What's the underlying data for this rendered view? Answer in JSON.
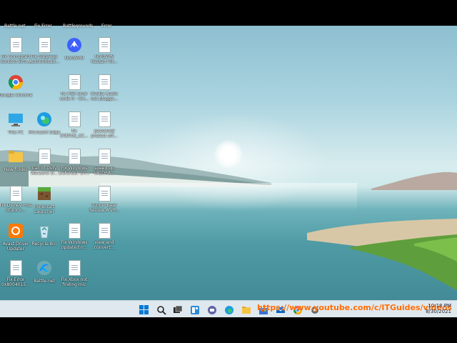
{
  "desktop": {
    "top_labels": [
      "Battle.net",
      "Fix Error",
      "Battlegrounds",
      "Error"
    ],
    "icons": [
      {
        "label": "Fix Corrupted Content Erro...",
        "type": "doc"
      },
      {
        "label": "Fix Gateway Authenticati...",
        "type": "doc"
      },
      {
        "label": "NordVPN",
        "type": "nordvpn"
      },
      {
        "label": "NordVPN Restart Vir...",
        "type": "doc"
      },
      {
        "label": "Google Chrome",
        "type": "chrome"
      },
      {
        "label": "fix PSR error code 0 - CH...",
        "type": "doc"
      },
      {
        "label": "Nvidia Audio not plugge...",
        "type": "doc"
      },
      {
        "label": "This PC",
        "type": "pc"
      },
      {
        "label": "Microsoft Edge",
        "type": "edge"
      },
      {
        "label": "fix STATUS_AC...",
        "type": "doc"
      },
      {
        "label": "password protect off...",
        "type": "doc"
      },
      {
        "label": "New folder",
        "type": "folder"
      },
      {
        "label": "Call of Duty Warzone D...",
        "type": "doc"
      },
      {
        "label": "Fix Windows Defender err...",
        "type": "doc"
      },
      {
        "label": "speed up VALORA...",
        "type": "doc"
      },
      {
        "label": "Fix Disney Plus Stuck o...",
        "type": "doc"
      },
      {
        "label": "Minecraft Launcher",
        "type": "minecraft"
      },
      {
        "label": "Tunnel Bear Review A VP...",
        "type": "doc"
      },
      {
        "label": "Avast Driver Updater",
        "type": "avast"
      },
      {
        "label": "Recycle Bin",
        "type": "recycle"
      },
      {
        "label": "Fix Windows Update Err...",
        "type": "doc"
      },
      {
        "label": "view and convert...",
        "type": "doc"
      },
      {
        "label": "Fix Error 0x8004015...",
        "type": "doc"
      },
      {
        "label": "Battle.net",
        "type": "battlenet"
      },
      {
        "label": "Fix Xbox not finding mic",
        "type": "doc"
      }
    ]
  },
  "taskbar": {
    "apps": [
      "start-icon",
      "search-icon",
      "task-view-icon",
      "widgets-icon",
      "chat-icon",
      "edge-icon",
      "file-explorer-icon",
      "store-icon",
      "mail-icon",
      "chrome-icon",
      "settings-icon"
    ],
    "watermark": "https://www.youtube.com/c/ITGuides/videos",
    "time": "10:18 PM",
    "date": "8/30/2021"
  },
  "colors": {
    "accent": "#0078d4",
    "watermark": "#ff6a00"
  }
}
